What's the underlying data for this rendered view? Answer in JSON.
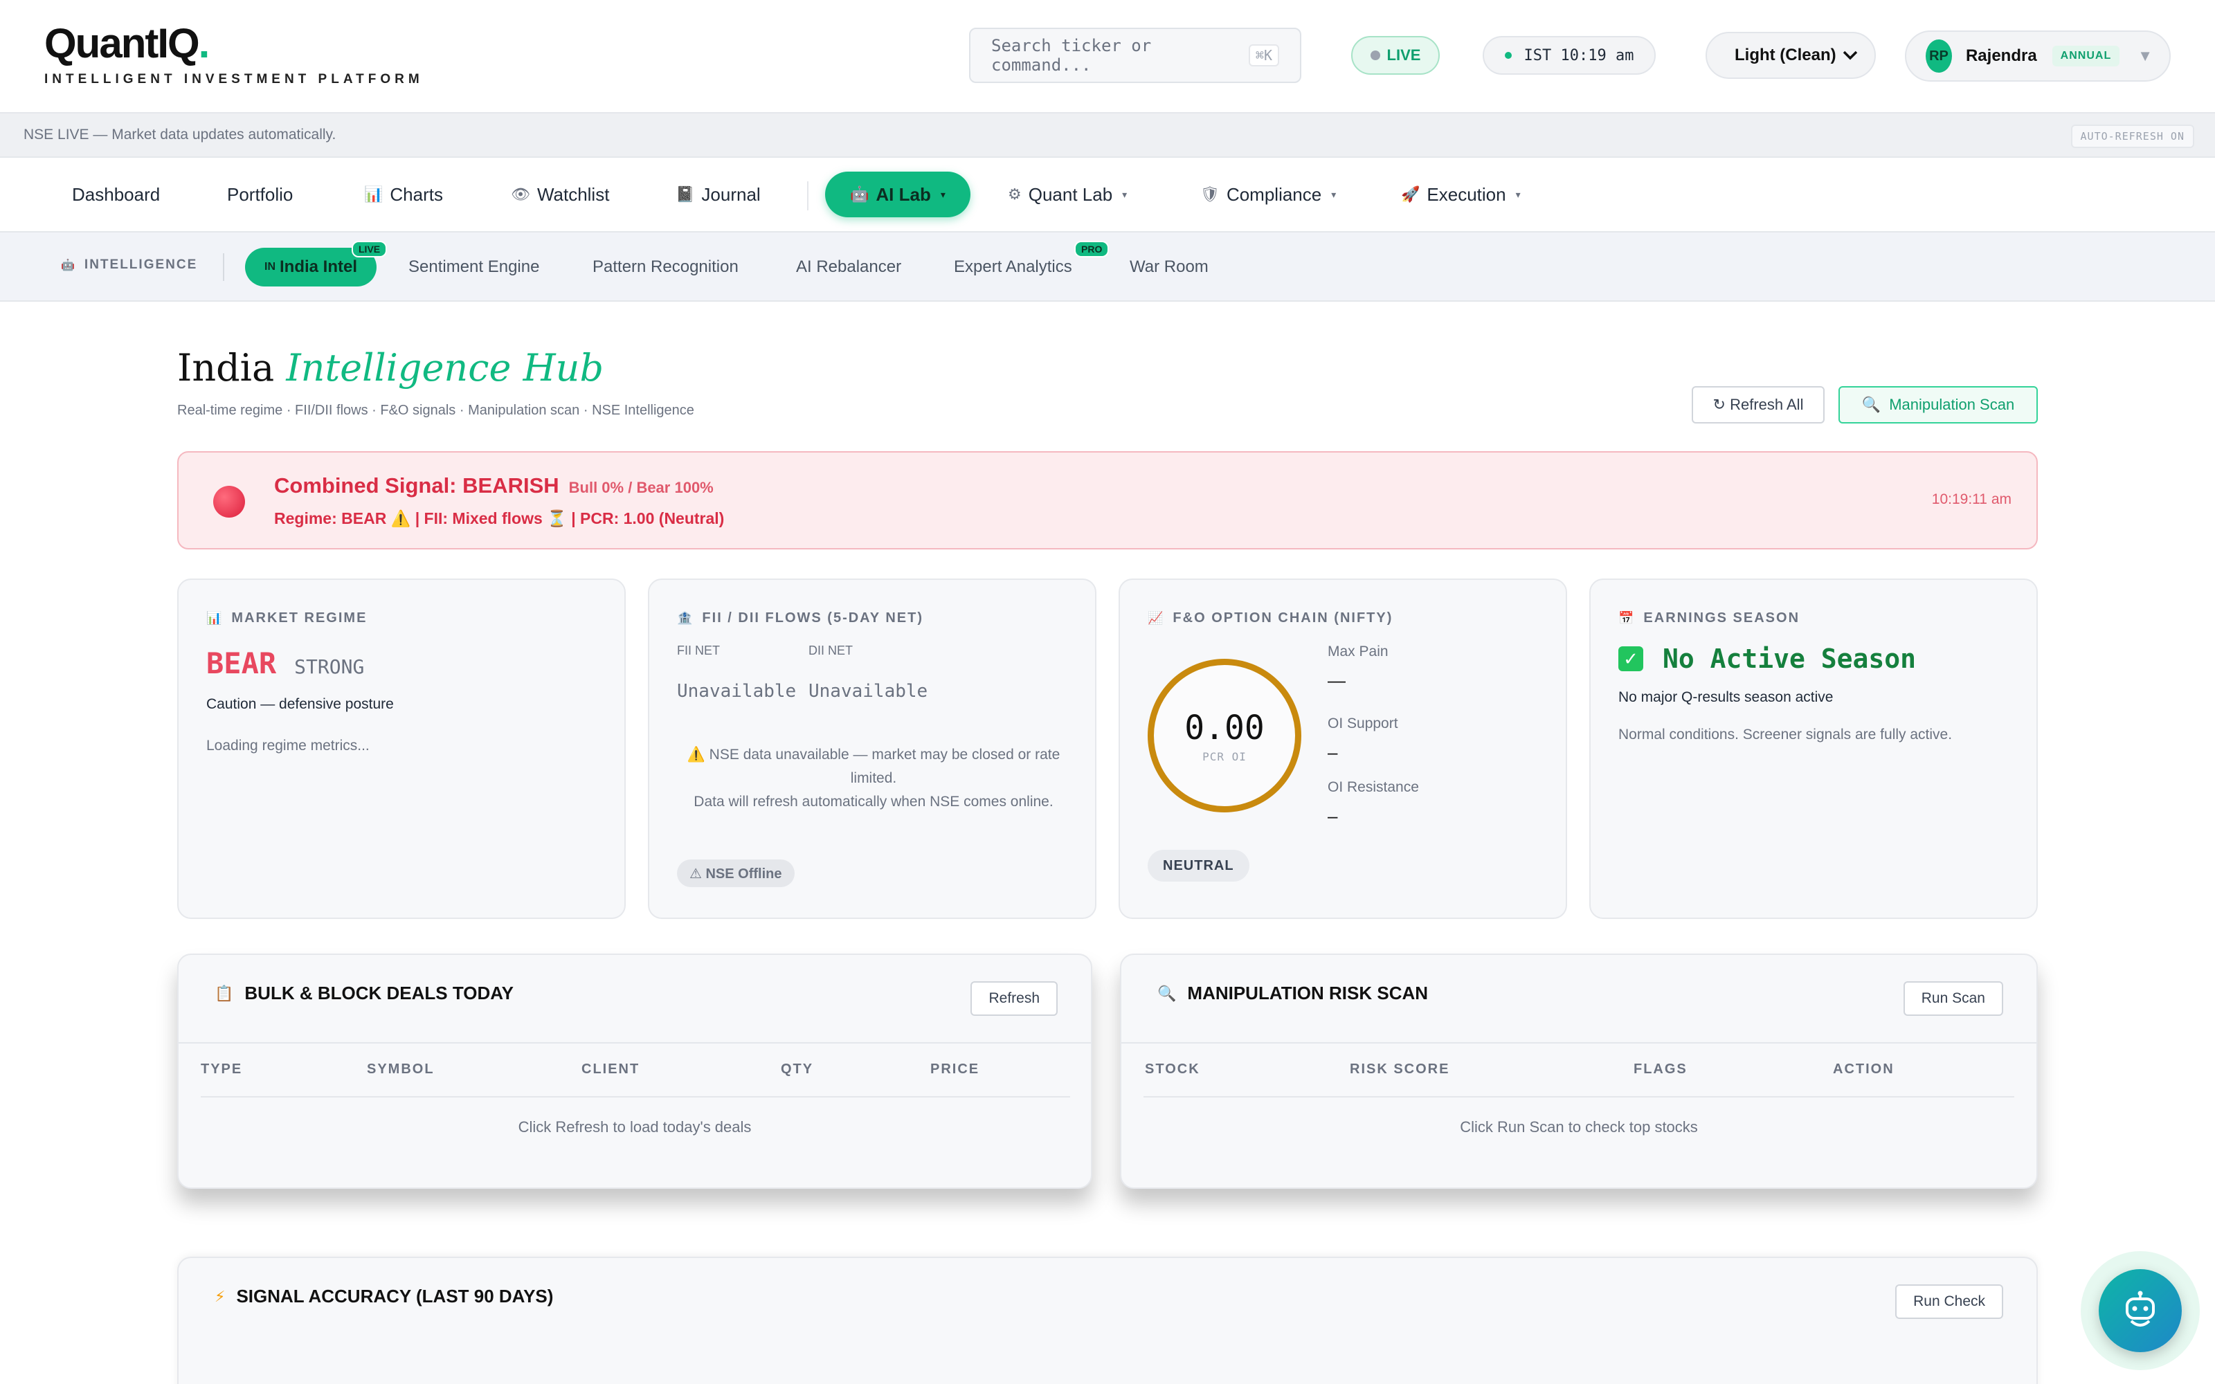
{
  "brand": {
    "name": "QuantIQ",
    "dot": ".",
    "tagline": "INTELLIGENT INVESTMENT PLATFORM"
  },
  "header": {
    "search_placeholder": "Search ticker or command...",
    "search_shortcut": "⌘K",
    "live_label": "LIVE",
    "clock": "IST 10:19 am",
    "theme_selected": "Light (Clean)",
    "user": {
      "initials": "RP",
      "name": "Rajendra",
      "plan": "ANNUAL"
    }
  },
  "notice": {
    "text": "NSE LIVE — Market data updates automatically.",
    "auto_refresh": "AUTO-REFRESH ON"
  },
  "main_nav": [
    {
      "label": "Dashboard"
    },
    {
      "label": "Portfolio"
    },
    {
      "label": "Charts",
      "icon": "📊"
    },
    {
      "label": "Watchlist",
      "icon": "👁"
    },
    {
      "label": "Journal",
      "icon": "📓"
    },
    {
      "label": "AI Lab",
      "icon": "🤖",
      "active": true
    },
    {
      "label": "Quant Lab",
      "icon": "⚙"
    },
    {
      "label": "Compliance",
      "icon": "🛡"
    },
    {
      "label": "Execution",
      "icon": "🚀"
    }
  ],
  "sub_nav": {
    "section_label": "INTELLIGENCE",
    "items": [
      {
        "label": "India Intel",
        "prefix": "IN",
        "badge": "LIVE",
        "active": true
      },
      {
        "label": "Sentiment Engine"
      },
      {
        "label": "Pattern Recognition"
      },
      {
        "label": "AI Rebalancer"
      },
      {
        "label": "Expert Analytics",
        "badge": "PRO"
      },
      {
        "label": "War Room"
      }
    ]
  },
  "page": {
    "title_plain": "India",
    "title_accent": "Intelligence Hub",
    "subtitle": "Real-time regime · FII/DII flows · F&O signals · Manipulation scan · NSE Intelligence",
    "refresh_all": "↻ Refresh All",
    "manipulation_scan": "Manipulation Scan"
  },
  "signal": {
    "title": "Combined Signal: BEARISH",
    "ratio": "Bull 0% / Bear 100%",
    "detail": "Regime: BEAR ⚠️ | FII: Mixed flows ⏳ | PCR: 1.00 (Neutral)",
    "time": "10:19:11 am"
  },
  "cards": {
    "regime": {
      "heading": "MARKET REGIME",
      "value": "BEAR",
      "strength": "STRONG",
      "note": "Caution — defensive posture",
      "loading": "Loading regime metrics..."
    },
    "fii": {
      "heading": "FII / DII FLOWS (5-DAY NET)",
      "fii_label": "FII NET",
      "dii_label": "DII NET",
      "fii_value": "Unavailable",
      "dii_value": "Unavailable",
      "message_1": "⚠️ NSE data unavailable — market may be closed or rate limited.",
      "message_2": "Data will refresh automatically when NSE comes online.",
      "badge": "⚠ NSE Offline"
    },
    "option_chain": {
      "heading": "F&O OPTION CHAIN (NIFTY)",
      "pcr_value": "0.00",
      "pcr_label": "PCR OI",
      "max_pain_label": "Max Pain",
      "max_pain_value": "—",
      "oi_support_label": "OI Support",
      "oi_support_value": "–",
      "oi_resistance_label": "OI Resistance",
      "oi_resistance_value": "–",
      "sentiment": "NEUTRAL"
    },
    "earnings": {
      "heading": "EARNINGS SEASON",
      "title": "No Active Season",
      "note": "No major Q-results season active",
      "sub": "Normal conditions. Screener signals are fully active."
    }
  },
  "bulk_deals": {
    "title": "BULK & BLOCK DEALS TODAY",
    "button": "Refresh",
    "columns": [
      "TYPE",
      "SYMBOL",
      "CLIENT",
      "QTY",
      "PRICE"
    ],
    "empty": "Click Refresh to load today's deals"
  },
  "manipulation": {
    "title": "MANIPULATION RISK SCAN",
    "button": "Run Scan",
    "columns": [
      "STOCK",
      "RISK SCORE",
      "FLAGS",
      "ACTION"
    ],
    "empty": "Click Run Scan to check top stocks"
  },
  "accuracy": {
    "title": "SIGNAL ACCURACY (LAST 90 DAYS)",
    "button": "Run Check"
  },
  "colors": {
    "accent": "#10b981",
    "bear": "#e8485f",
    "signal_bg": "#fdecee",
    "pcr_ring": "#c98a0e",
    "earnings_ok": "#15803d"
  }
}
